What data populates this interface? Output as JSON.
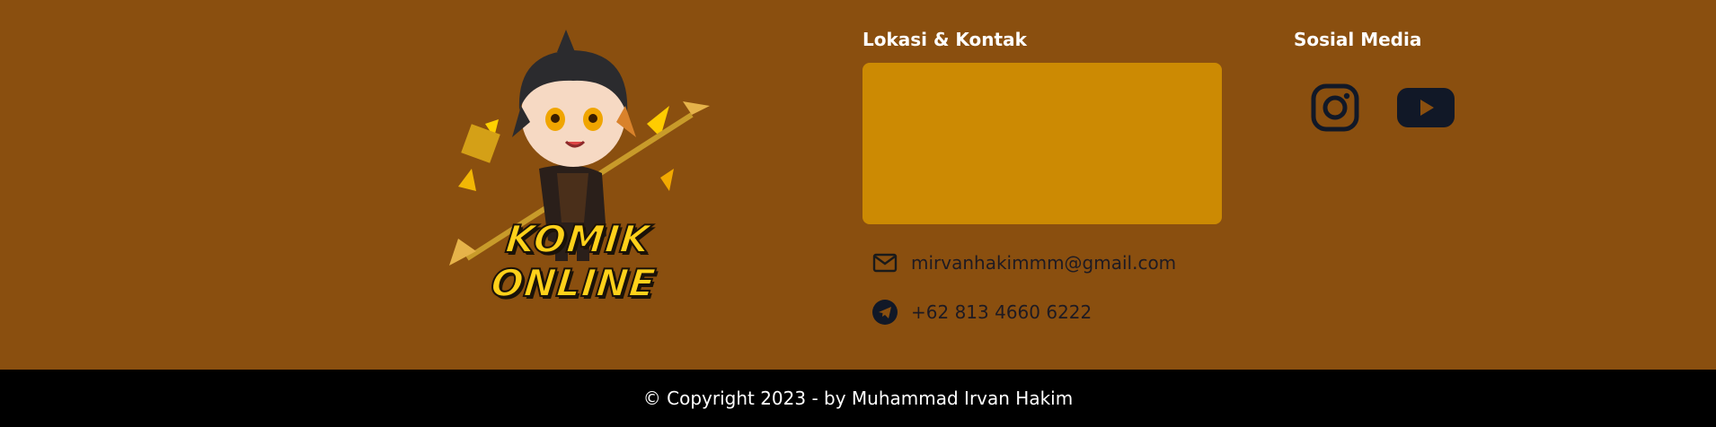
{
  "brand": {
    "logo_text": "KOMIK ONLINE"
  },
  "contact": {
    "title": "Lokasi & Kontak",
    "email": "mirvanhakimmm@gmail.com",
    "phone": "+62 813 4660 6222",
    "email_icon": "mail-icon",
    "phone_icon": "telegram-icon"
  },
  "social": {
    "title": "Sosial Media",
    "items": [
      {
        "name": "instagram-icon"
      },
      {
        "name": "youtube-icon"
      }
    ]
  },
  "footer": {
    "copyright": "© Copyright 2023 - by Muhammad Irvan Hakim"
  },
  "colors": {
    "background": "#8a4f0f",
    "map_placeholder": "#cc8a03",
    "bar": "#000000",
    "icon_dark": "#111827"
  }
}
